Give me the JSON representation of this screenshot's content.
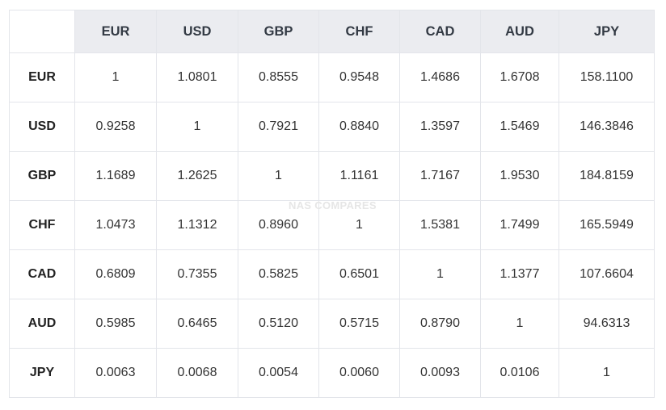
{
  "watermark": "NAS COMPARES",
  "table": {
    "columns": [
      "EUR",
      "USD",
      "GBP",
      "CHF",
      "CAD",
      "AUD",
      "JPY"
    ],
    "rows": [
      {
        "label": "EUR",
        "values": [
          "1",
          "1.0801",
          "0.8555",
          "0.9548",
          "1.4686",
          "1.6708",
          "158.1100"
        ]
      },
      {
        "label": "USD",
        "values": [
          "0.9258",
          "1",
          "0.7921",
          "0.8840",
          "1.3597",
          "1.5469",
          "146.3846"
        ]
      },
      {
        "label": "GBP",
        "values": [
          "1.1689",
          "1.2625",
          "1",
          "1.1161",
          "1.7167",
          "1.9530",
          "184.8159"
        ]
      },
      {
        "label": "CHF",
        "values": [
          "1.0473",
          "1.1312",
          "0.8960",
          "1",
          "1.5381",
          "1.7499",
          "165.5949"
        ]
      },
      {
        "label": "CAD",
        "values": [
          "0.6809",
          "0.7355",
          "0.5825",
          "0.6501",
          "1",
          "1.1377",
          "107.6604"
        ]
      },
      {
        "label": "AUD",
        "values": [
          "0.5985",
          "0.6465",
          "0.5120",
          "0.5715",
          "0.8790",
          "1",
          "94.6313"
        ]
      },
      {
        "label": "JPY",
        "values": [
          "0.0063",
          "0.0068",
          "0.0054",
          "0.0060",
          "0.0093",
          "0.0106",
          "1"
        ]
      }
    ]
  }
}
